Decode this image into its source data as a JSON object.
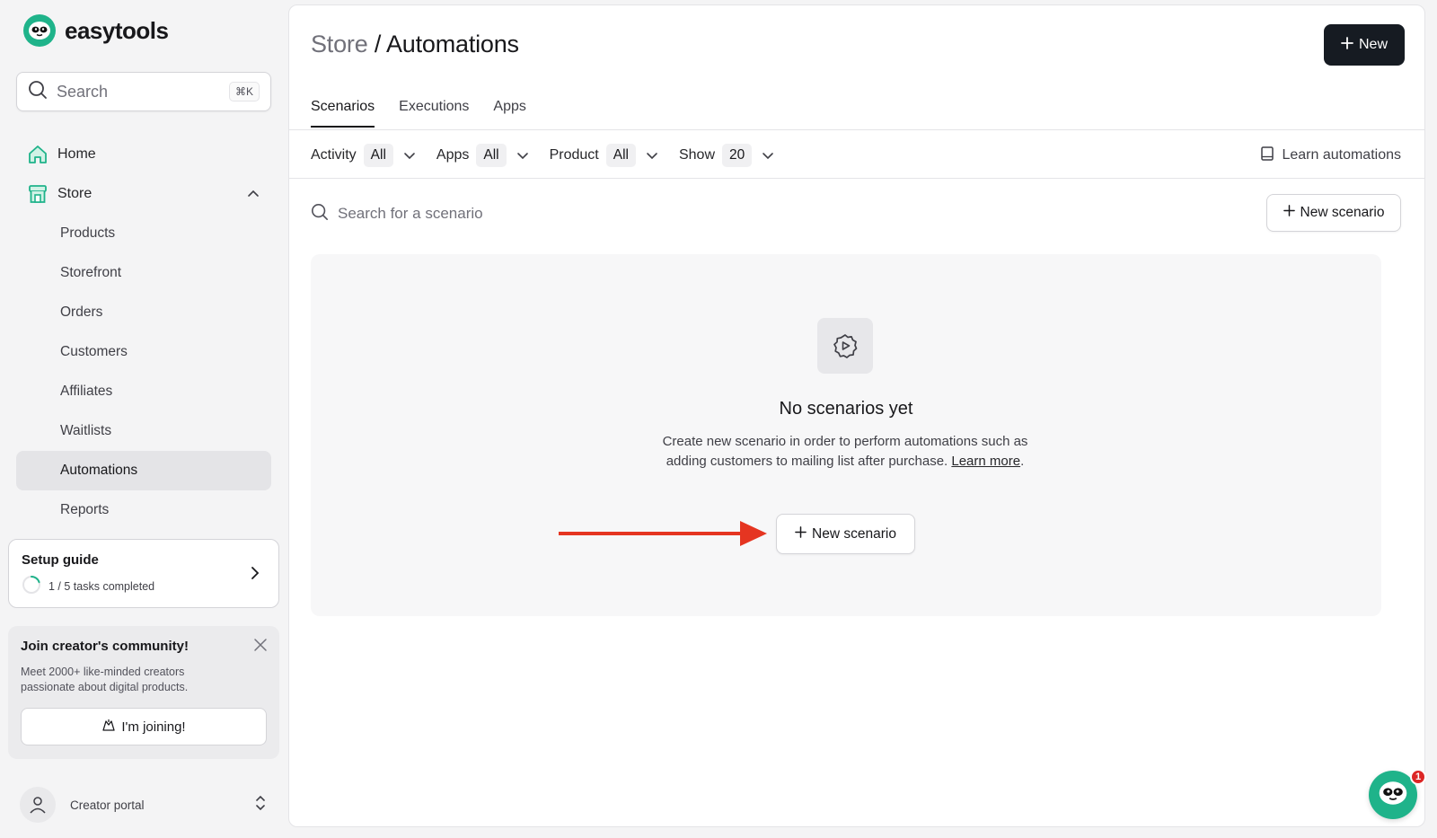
{
  "brand": {
    "name": "easytools",
    "accent": "#1fb38a"
  },
  "sidebar": {
    "search": {
      "placeholder": "Search",
      "shortcut": "⌘K"
    },
    "nav": {
      "home": "Home",
      "store": "Store",
      "sub": [
        "Products",
        "Storefront",
        "Orders",
        "Customers",
        "Affiliates",
        "Waitlists",
        "Automations",
        "Reports"
      ],
      "active": "Automations"
    },
    "setup": {
      "title": "Setup guide",
      "progress_text": "1 / 5 tasks completed",
      "completed": 1,
      "total": 5
    },
    "community": {
      "title": "Join creator's community!",
      "text": "Meet 2000+ like-minded creators passionate about digital products.",
      "button": "I'm joining!"
    },
    "portal": {
      "label": "Creator portal"
    }
  },
  "header": {
    "crumb": "Store",
    "separator": " / ",
    "title": "Automations",
    "new_button": "New"
  },
  "tabs": [
    "Scenarios",
    "Executions",
    "Apps"
  ],
  "active_tab": "Scenarios",
  "filters": [
    {
      "label": "Activity",
      "value": "All"
    },
    {
      "label": "Apps",
      "value": "All"
    },
    {
      "label": "Product",
      "value": "All"
    },
    {
      "label": "Show",
      "value": "20"
    }
  ],
  "learn_link": "Learn automations",
  "scenario_search": {
    "placeholder": "Search for a scenario"
  },
  "new_scenario_button": "New scenario",
  "empty_state": {
    "title": "No scenarios yet",
    "text": "Create new scenario in order to perform automations such as adding customers to mailing list after purchase.",
    "link": "Learn more",
    "period": ".",
    "button": "New scenario"
  },
  "chat": {
    "badge": "1"
  },
  "colors": {
    "primary_button": "#161b22",
    "annotation_arrow": "#e53521"
  }
}
